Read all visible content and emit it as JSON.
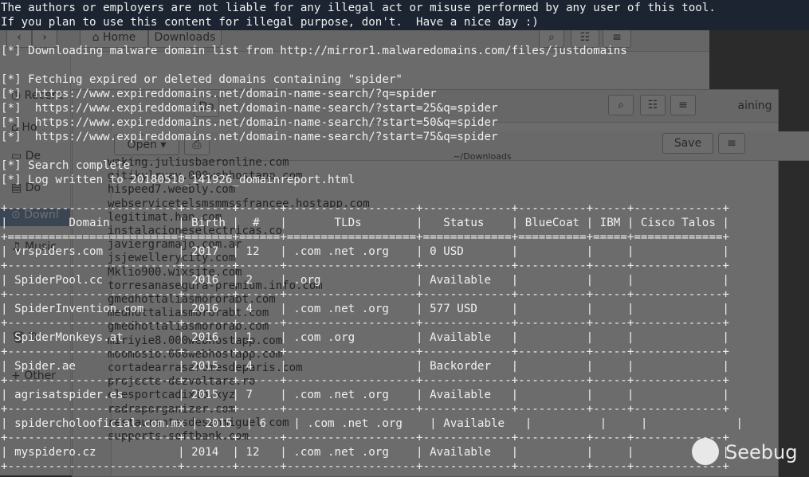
{
  "colors": {
    "terminal_text": "#f0f0f0",
    "terminal_bg": "#2b2b2b",
    "sidebar_active": "#5a7fa8"
  },
  "background": {
    "fm1": {
      "nav_back_icon": "chevron-left-icon",
      "home_label": "Home",
      "downloads_label": "Downloads",
      "sidebar": [
        "Recent",
        "Ho",
        "De",
        "Do",
        "Downl",
        "Music",
        "Tr",
        "Other"
      ]
    },
    "fm2": {
      "title": "Do",
      "partial_label": "aining"
    },
    "fm3": {
      "open_label": "Open",
      "save_label": "Save",
      "path_label": "~/Downloads"
    },
    "files": [
      "waking.juliusbaeronline.com",
      "gjtikylryey.000webhostapp.com",
      "hispeed7.weebly.com",
      "webservicetelsmsmmssfrancee.hostapp.com",
      "legitimat.han.com",
      "instalacioneselectricas.co",
      "javiergramajo.com.ar",
      "jsjewellerycity.com",
      "Mklio900.wixsite.com",
      "torresanasegura-premium.info.com",
      "gmedhottaliasmororabt.com",
      "medhottaliasmororabt.com",
      "gmedhottaliasmororab.com",
      "miriyie8.000webhostapp.com",
      "moomosio.000webhostapp.com",
      "cortadearrasaromesdeparis.com",
      "projecte-dezvoltare.ro",
      "elesportcadixio.xyz",
      "radraporganizer.com",
      "restaurantesdesanmiguel.com",
      "supports-softbank.com"
    ]
  },
  "terminal": {
    "disclaimer1": "The authors or employers are not liable for any illegal act or misuse performed by any user of this tool.",
    "disclaimer2": "If you plan to use this content for illegal purpose, don't.  Have a nice day :)",
    "downloading": "[*] Downloading malware domain list from http://mirror1.malwaredomains.com/files/justdomains",
    "fetching": "[*] Fetching expired or deleted domains containing \"spider\"",
    "urls": [
      "[*]  https://www.expireddomains.net/domain-name-search/?q=spider",
      "[*]  https://www.expireddomains.net/domain-name-search/?start=25&q=spider",
      "[*]  https://www.expireddomains.net/domain-name-search/?start=50&q=spider",
      "[*]  https://www.expireddomains.net/domain-name-search/?start=75&q=spider"
    ],
    "search_complete": "[*] Search complete",
    "log_written": "[*] Log written to 20180510_141926_domainreport.html",
    "table": {
      "border_top": "+-------------------------+-------+------+-------------------+-------------+----------+-----+-------------+",
      "header": "|         Domain          | Birth |  #   |       TLDs        |   Status    | BlueCoat | IBM | Cisco Talos |",
      "header_sep": "+=========================+=======+======+===================+=============+==========+=====+=============+",
      "row_sep": "+-------------------------+-------+------+-------------------+-------------+----------+-----+-------------+",
      "rows": [
        "| vrspiders.com           | 2017  | 12   | .com .net .org    | 0 USD       |          |     |             |",
        "| SpiderPool.cc           | 2016  | 2    | .org              | Available   |          |     |             |",
        "| SpiderInvention.com     | 2016  | 4    | .com .net .org    | 577 USD     |          |     |             |",
        "| SpiderMonkeys.at        | 2016  | 1    | .com .org         | Available   |          |     |             |",
        "| Spider.ae               | 2015  | 4    |                   | Backorder   |          |     |             |",
        "| agrisatspider.es        | 2015  | 7    | .com .net .org    | Available   |          |     |             |",
        "| spidercholooficial.com.mx | 2015  | 6    | .com .net .org    | Available   |          |     |             |",
        "| myspidero.cz            | 2014  | 12   | .com .net .org    | Available   |          |     |             |"
      ]
    }
  },
  "watermark": {
    "logo_icon": "seebug-logo-icon",
    "text": "Seebug"
  }
}
